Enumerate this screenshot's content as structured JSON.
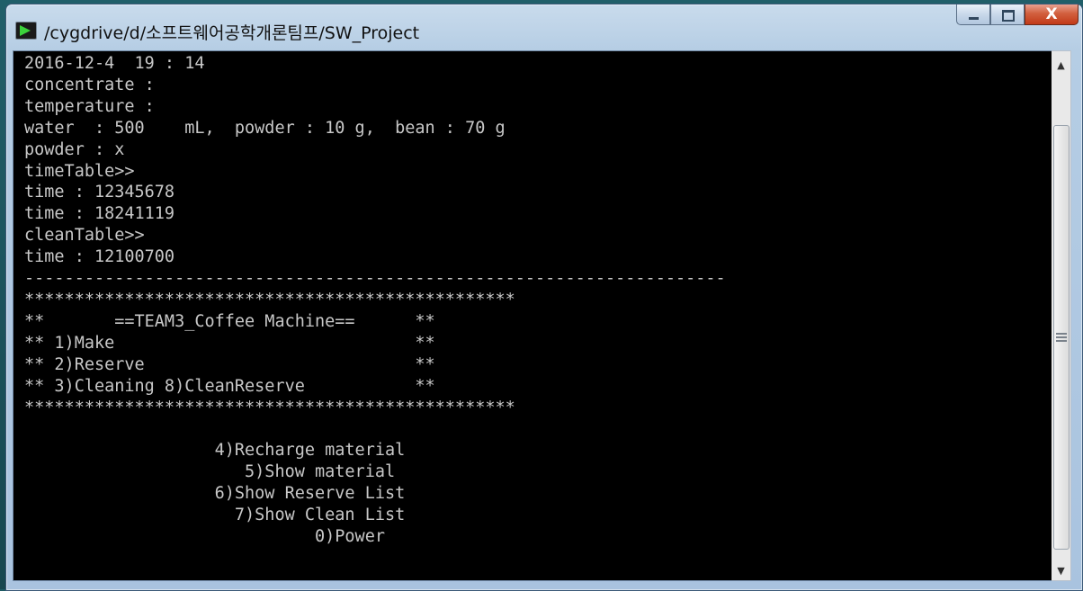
{
  "window": {
    "title": "/cygdrive/d/소프트웨어공학개론팀프/SW_Project",
    "icons": {
      "app": "cygwin-terminal-icon",
      "minimize": "minimize-icon",
      "maximize": "maximize-icon",
      "close": "close-icon"
    },
    "close_glyph": "X"
  },
  "console": {
    "lines": [
      "2016-12-4  19 : 14",
      "concentrate :",
      "temperature :",
      "water  : 500    mL,  powder : 10 g,  bean : 70 g",
      "powder : x",
      "timeTable>>",
      "time : 12345678",
      "time : 18241119",
      "cleanTable>>",
      "time : 12100700",
      "----------------------------------------------------------------------",
      "*************************************************",
      "**       ==TEAM3_Coffee Machine==      **",
      "** 1)Make                              **",
      "** 2)Reserve                           **",
      "** 3)Cleaning 8)CleanReserve           **",
      "*************************************************",
      "",
      "                   4)Recharge material",
      "                      5)Show material",
      "                   6)Show Reserve List",
      "                     7)Show Clean List",
      "                             0)Power"
    ]
  },
  "scrollbar": {
    "up_glyph": "▲",
    "down_glyph": "▼"
  },
  "colors": {
    "console_bg": "#000000",
    "console_fg": "#c8c8c8",
    "close_button": "#c23a18"
  }
}
